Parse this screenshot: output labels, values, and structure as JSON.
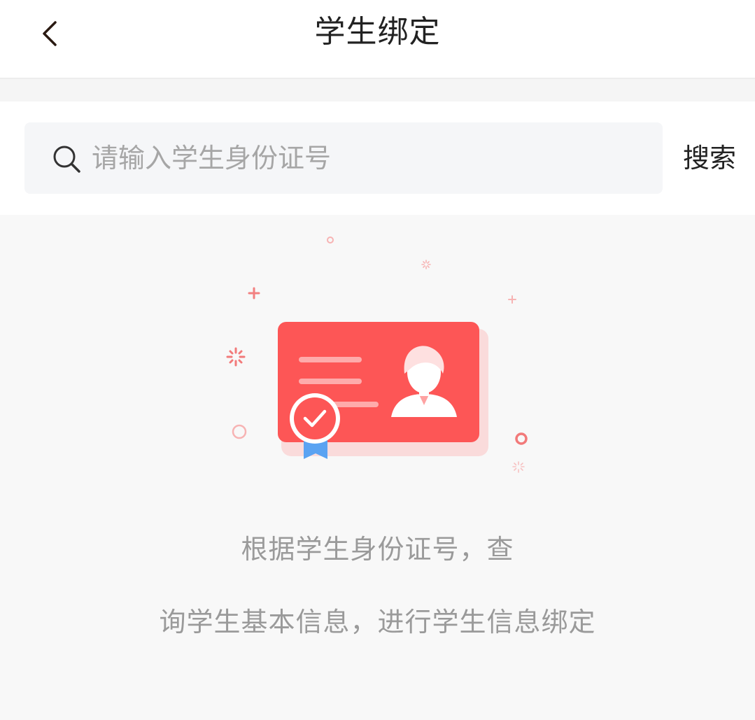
{
  "header": {
    "title": "学生绑定",
    "back_icon": "chevron-left-icon"
  },
  "search": {
    "placeholder": "请输入学生身份证号",
    "value": "",
    "button_label": "搜索",
    "icon": "search-icon"
  },
  "empty_state": {
    "illustration": "student-id-card-illustration",
    "line1": "根据学生身份证号，查",
    "line2": "询学生基本信息，进行学生信息绑定"
  },
  "colors": {
    "accent": "#fd5656",
    "badge_ribbon": "#5aa3f2",
    "text_primary": "#222222",
    "text_secondary": "#9a9a9a"
  }
}
